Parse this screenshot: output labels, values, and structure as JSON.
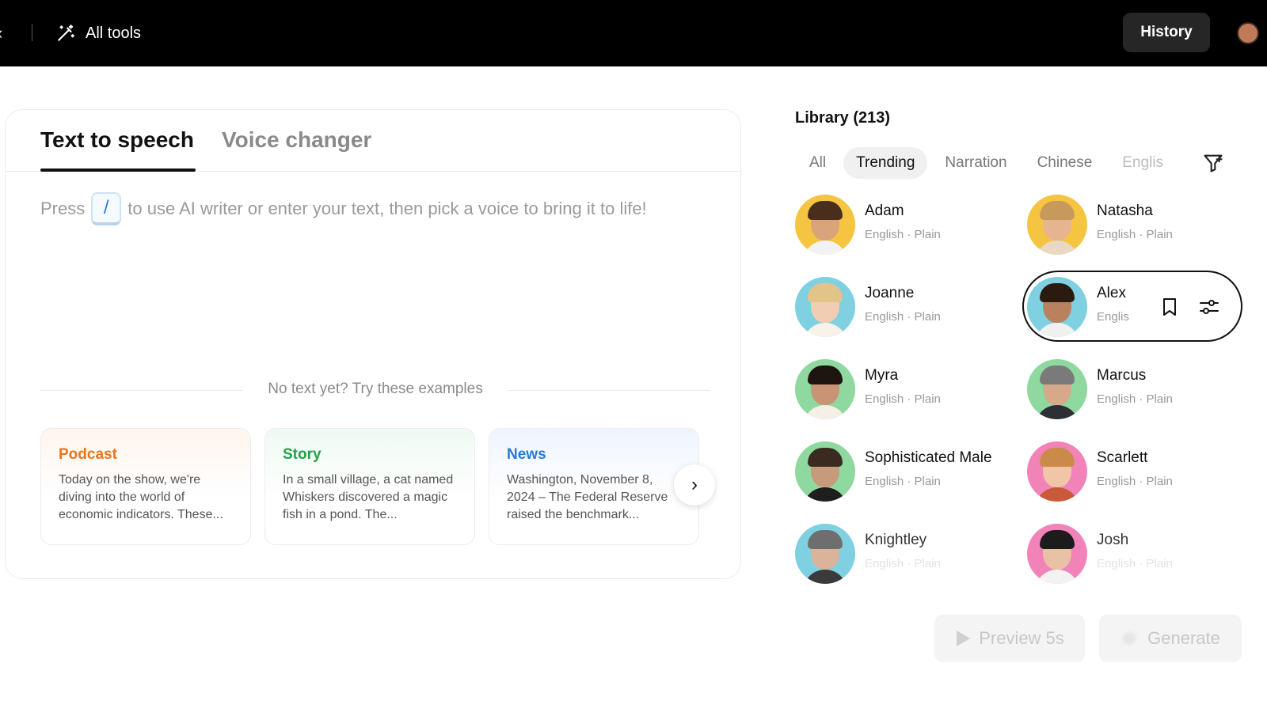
{
  "topbar": {
    "all_tools_label": "All tools",
    "history_label": "History"
  },
  "editor": {
    "tabs": [
      {
        "label": "Text to speech",
        "active": true
      },
      {
        "label": "Voice changer",
        "active": false
      }
    ],
    "hint_prefix": "Press",
    "hint_key": "/",
    "hint_suffix": "to use AI writer or enter your text, then pick a voice to bring it to life!",
    "examples_heading": "No text yet? Try these examples",
    "examples": [
      {
        "title": "Podcast",
        "body": "Today on the show, we're diving into the world of economic indicators. These..."
      },
      {
        "title": "Story",
        "body": "In a small village, a cat named Whiskers discovered a magic fish in a pond. The..."
      },
      {
        "title": "News",
        "body": "Washington, November 8, 2024 – The Federal Reserve raised the benchmark..."
      }
    ]
  },
  "library": {
    "title": "Library (213)",
    "filters": [
      "All",
      "Trending",
      "Narration",
      "Chinese",
      "Englis"
    ],
    "active_filter": "Trending",
    "voices": [
      {
        "name": "Adam",
        "meta": "English · Plain",
        "bg": "#f5c542",
        "skin": "#d9a37c",
        "hair": "#4a2e1c",
        "shirt": "#f2f2f2"
      },
      {
        "name": "Natasha",
        "meta": "English · Plain",
        "bg": "#f5c542",
        "skin": "#e6b48f",
        "hair": "#c79a5c",
        "shirt": "#e9d8c4"
      },
      {
        "name": "Joanne",
        "meta": "English · Plain",
        "bg": "#7fd0e0",
        "skin": "#f0cdb3",
        "hair": "#e2c48a",
        "shirt": "#f7f2ea"
      },
      {
        "name": "Alex",
        "meta": "Englis",
        "bg": "#7fd0e0",
        "skin": "#b9825f",
        "hair": "#2b1a10",
        "shirt": "#f0f0f0"
      },
      {
        "name": "Myra",
        "meta": "English · Plain",
        "bg": "#8fd8a0",
        "skin": "#c99474",
        "hair": "#1e1410",
        "shirt": "#f5efe6"
      },
      {
        "name": "Marcus",
        "meta": "English · Plain",
        "bg": "#8fd8a0",
        "skin": "#d6a98a",
        "hair": "#7a7a7a",
        "shirt": "#2c2f36"
      },
      {
        "name": "Sophisticated Male",
        "meta": "English · Plain",
        "bg": "#8fd8a0",
        "skin": "#c79a7c",
        "hair": "#3a2a20",
        "shirt": "#1e1e1e"
      },
      {
        "name": "Scarlett",
        "meta": "English · Plain",
        "bg": "#f283b8",
        "skin": "#f1c6a6",
        "hair": "#c98a4a",
        "shirt": "#c85a3a"
      },
      {
        "name": "Knightley",
        "meta": "English · Plain",
        "bg": "#7fd0e0",
        "skin": "#d9b39a",
        "hair": "#6e6e6e",
        "shirt": "#3a3a3a"
      },
      {
        "name": "Josh",
        "meta": "English · Plain",
        "bg": "#f283b8",
        "skin": "#e9c1a4",
        "hair": "#1c1c1c",
        "shirt": "#f2f2f2"
      }
    ]
  },
  "actions": {
    "preview_label": "Preview 5s",
    "generate_label": "Generate"
  }
}
